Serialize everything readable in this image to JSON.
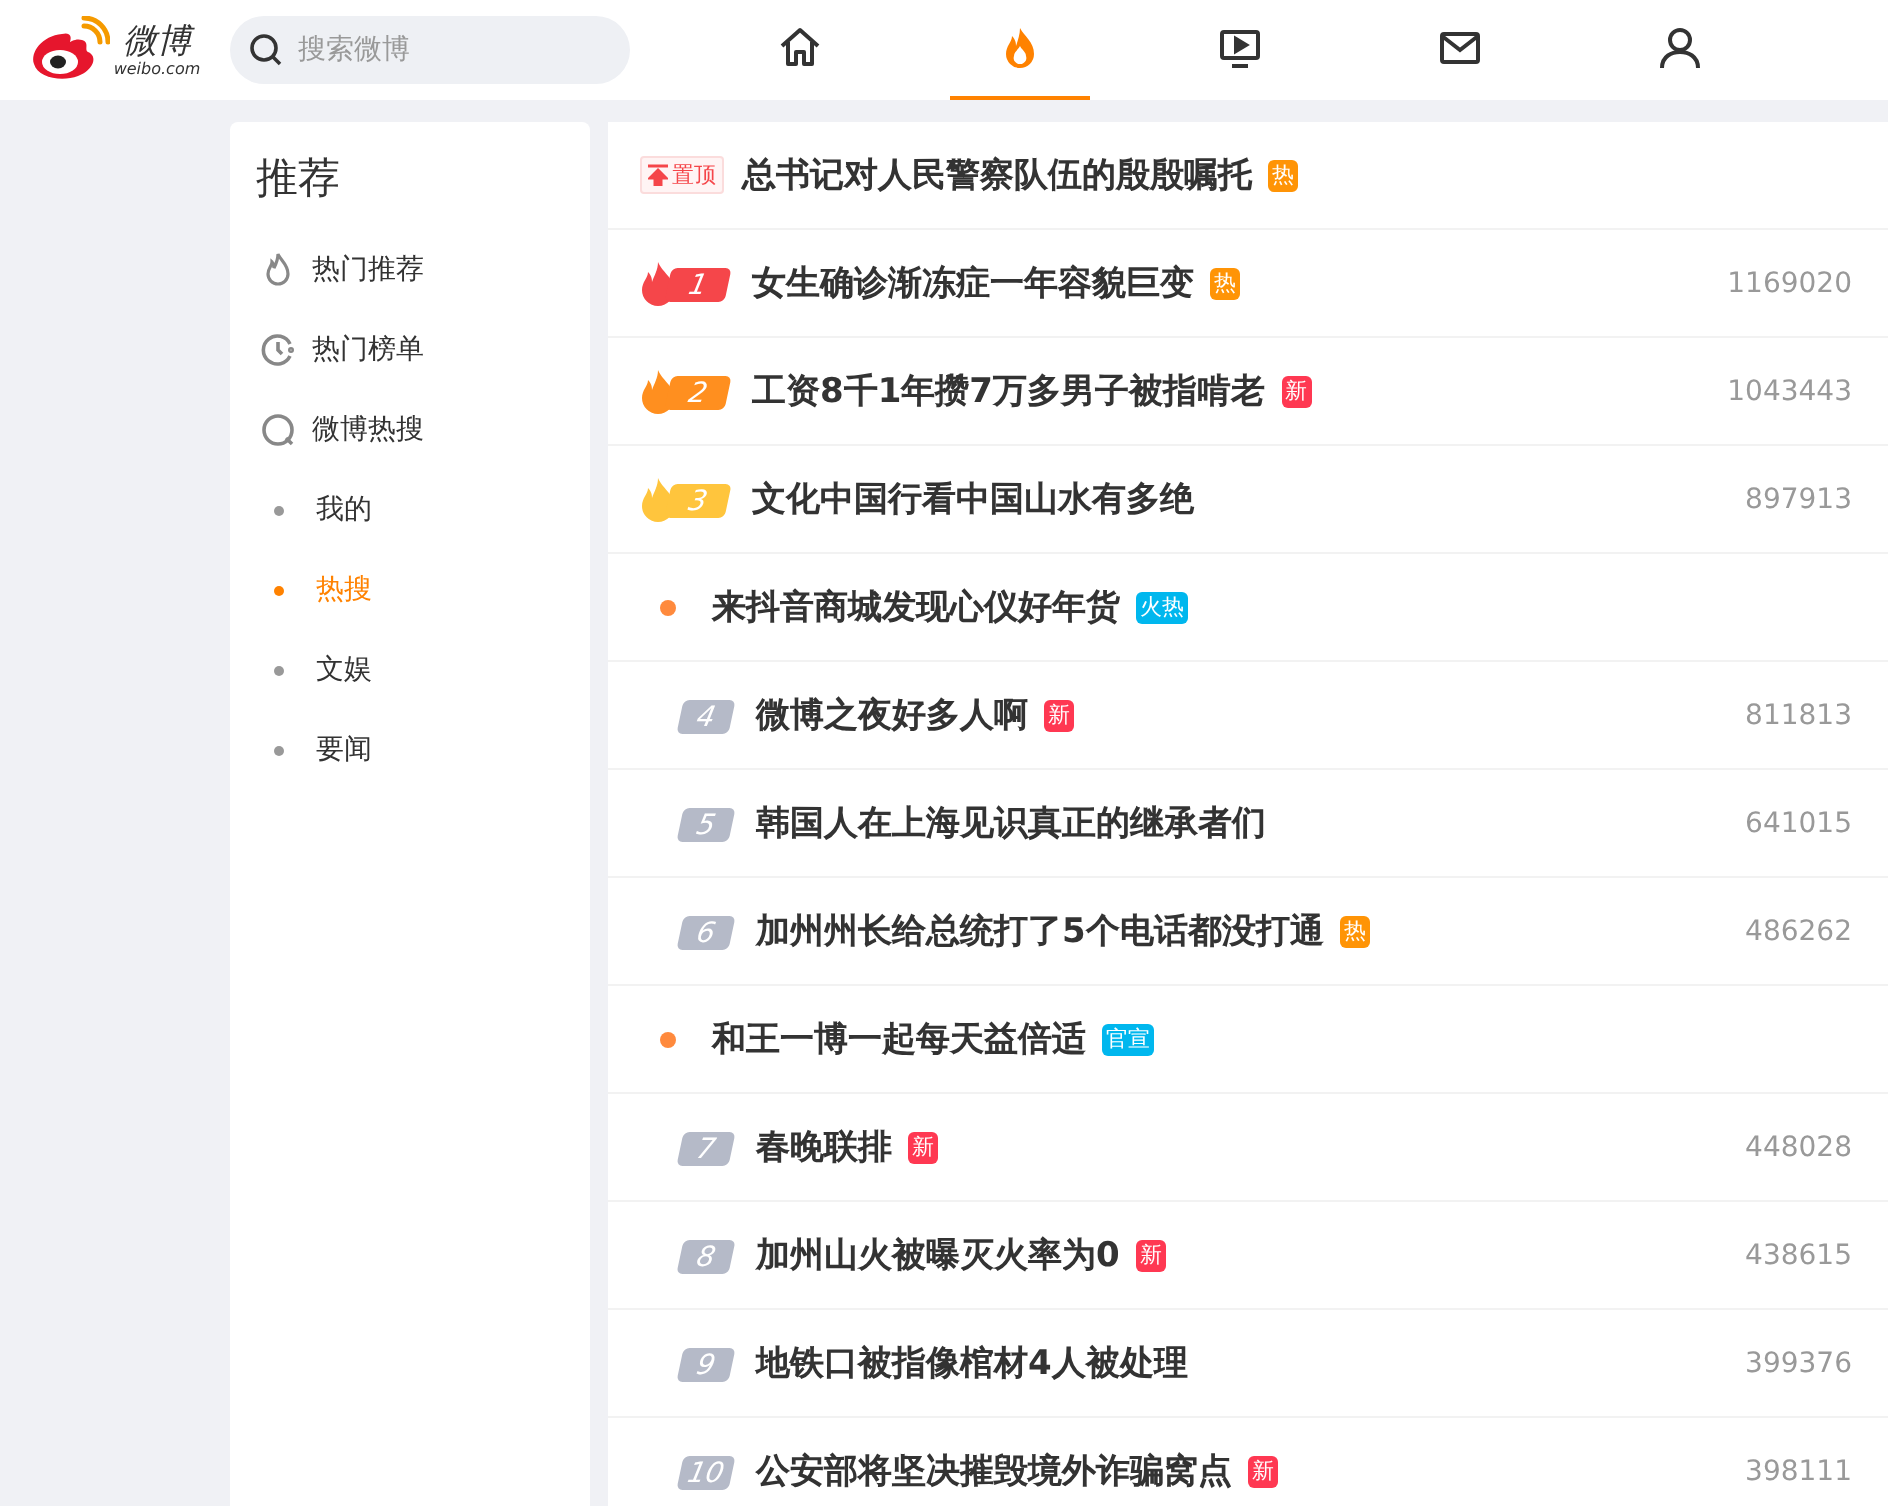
{
  "header": {
    "logo_name": "微博",
    "logo_text": "weibo.com",
    "search": {
      "placeholder": "搜索微博"
    },
    "nav": [
      {
        "selected": false
      },
      {
        "selected": true
      },
      {
        "selected": false
      },
      {
        "selected": false
      },
      {
        "selected": false
      }
    ]
  },
  "sidebar": {
    "title": "推荐",
    "items": [
      {
        "kind": "icon",
        "label": "热门推荐",
        "selected": false
      },
      {
        "kind": "icon",
        "label": "热门榜单",
        "selected": false
      },
      {
        "kind": "icon",
        "label": "微博热搜",
        "selected": false
      },
      {
        "kind": "sub",
        "label": "我的",
        "selected": false
      },
      {
        "kind": "sub",
        "label": "热搜",
        "selected": true
      },
      {
        "kind": "sub",
        "label": "文娱",
        "selected": false
      },
      {
        "kind": "sub",
        "label": "要闻",
        "selected": false
      }
    ]
  },
  "list": [
    {
      "kind": "pinned",
      "tag": "置顶",
      "title": "总书记对人民警察队伍的殷殷嘱托",
      "badge": {
        "text": "热",
        "color": "#ff9406"
      }
    },
    {
      "kind": "rank",
      "rank": "1",
      "color": "#f5464a",
      "flame": true,
      "title": "女生确诊渐冻症一年容貌巨变",
      "badge": {
        "text": "热",
        "color": "#ff9406"
      },
      "count": "1169020"
    },
    {
      "kind": "rank",
      "rank": "2",
      "color": "#ff8f1f",
      "flame": true,
      "title": "工资8千1年攒7万多男子被指啃老",
      "badge": {
        "text": "新",
        "color": "#ff3852"
      },
      "count": "1043443"
    },
    {
      "kind": "rank",
      "rank": "3",
      "color": "#ffc53d",
      "flame": true,
      "title": "文化中国行看中国山水有多绝",
      "count": "897913"
    },
    {
      "kind": "promo",
      "title": "来抖音商城发现心仪好年货",
      "badge": {
        "text": "火热",
        "color": "#00b7ee"
      }
    },
    {
      "kind": "rank",
      "rank": "4",
      "color": "#b5bac8",
      "flame": false,
      "title": "微博之夜好多人啊",
      "badge": {
        "text": "新",
        "color": "#ff3852"
      },
      "count": "811813"
    },
    {
      "kind": "rank",
      "rank": "5",
      "color": "#b5bac8",
      "flame": false,
      "title": "韩国人在上海见识真正的继承者们",
      "count": "641015"
    },
    {
      "kind": "rank",
      "rank": "6",
      "color": "#b5bac8",
      "flame": false,
      "title": "加州州长给总统打了5个电话都没打通",
      "badge": {
        "text": "热",
        "color": "#ff9406"
      },
      "count": "486262"
    },
    {
      "kind": "promo",
      "title": "和王一博一起每天益倍适",
      "badge": {
        "text": "官宣",
        "color": "#00b7ee"
      }
    },
    {
      "kind": "rank",
      "rank": "7",
      "color": "#b5bac8",
      "flame": false,
      "title": "春晚联排",
      "badge": {
        "text": "新",
        "color": "#ff3852"
      },
      "count": "448028"
    },
    {
      "kind": "rank",
      "rank": "8",
      "color": "#b5bac8",
      "flame": false,
      "title": "加州山火被曝灭火率为0",
      "badge": {
        "text": "新",
        "color": "#ff3852"
      },
      "count": "438615"
    },
    {
      "kind": "rank",
      "rank": "9",
      "color": "#b5bac8",
      "flame": false,
      "title": "地铁口被指像棺材4人被处理",
      "count": "399376"
    },
    {
      "kind": "rank",
      "rank": "10",
      "color": "#b5bac8",
      "flame": false,
      "title": "公安部将坚决摧毁境外诈骗窝点",
      "badge": {
        "text": "新",
        "color": "#ff3852"
      },
      "count": "398111"
    }
  ]
}
